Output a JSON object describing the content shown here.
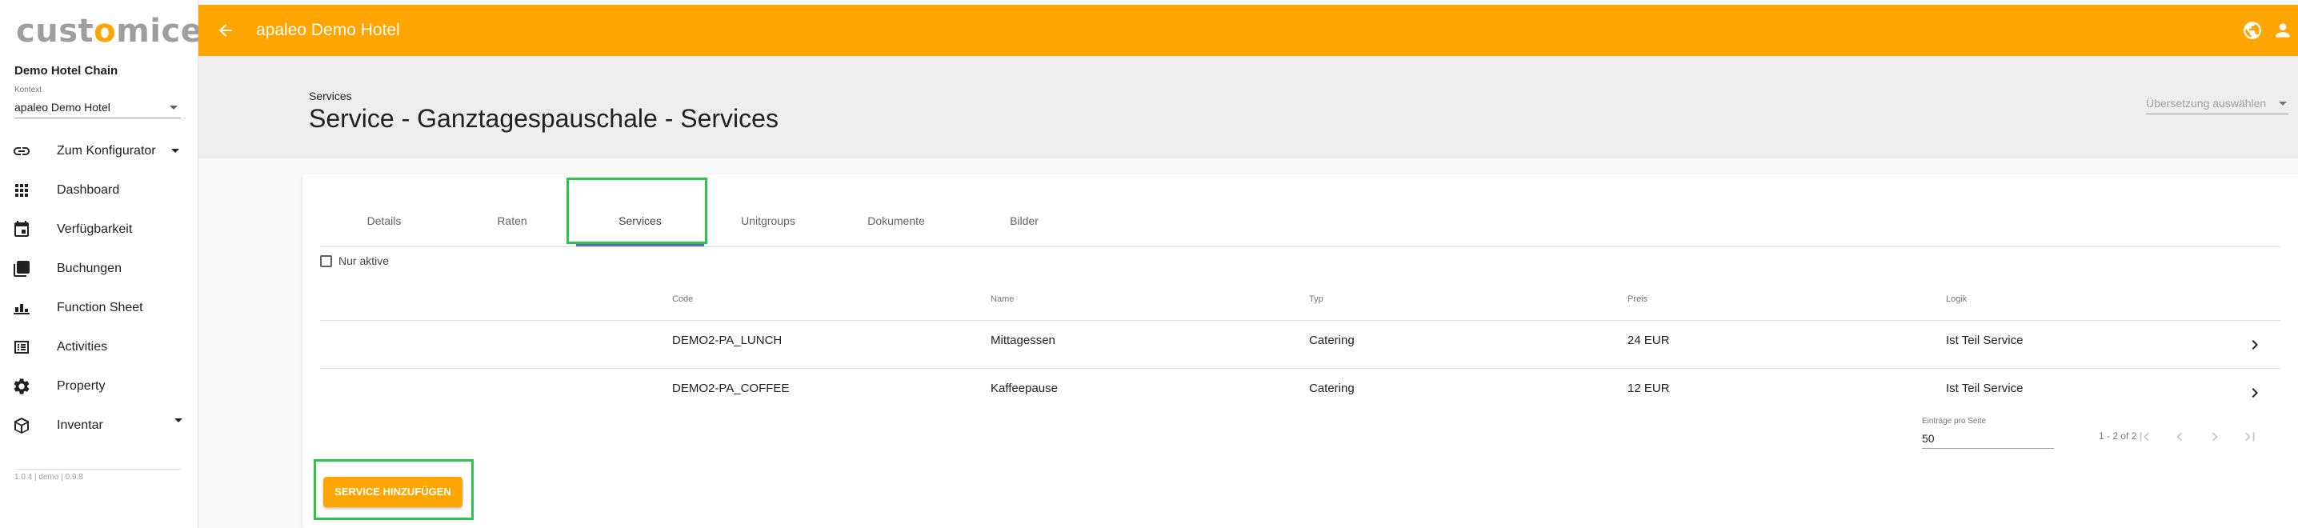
{
  "app": {
    "logo_prefix": "cust",
    "logo_dot": "o",
    "logo_suffix": "mice",
    "accent_color": "#ffa500",
    "highlight_color": "#2ec34a"
  },
  "sidebar": {
    "chain_name": "Demo Hotel Chain",
    "context_label": "Kontext",
    "context_value": "apaleo Demo Hotel",
    "items": [
      {
        "label": "Zum Konfigurator",
        "icon": "link-icon",
        "has_caret": true
      },
      {
        "label": "Dashboard",
        "icon": "grid-icon"
      },
      {
        "label": "Verfügbarkeit",
        "icon": "calendar-icon"
      },
      {
        "label": "Buchungen",
        "icon": "stack-icon"
      },
      {
        "label": "Function Sheet",
        "icon": "bar-chart-icon"
      },
      {
        "label": "Activities",
        "icon": "list-icon"
      },
      {
        "label": "Property",
        "icon": "gear-icon"
      },
      {
        "label": "Inventar",
        "icon": "cube-icon",
        "has_caret": true
      }
    ],
    "version": "1.0.4 | demo | 0.9.8"
  },
  "topbar": {
    "title": "apaleo Demo Hotel"
  },
  "header": {
    "breadcrumb": "Services",
    "title": "Service - Ganztagespauschale - Services",
    "translation_placeholder": "Übersetzung auswählen"
  },
  "tabs": [
    {
      "label": "Details"
    },
    {
      "label": "Raten"
    },
    {
      "label": "Services",
      "active": true
    },
    {
      "label": "Unitgroups"
    },
    {
      "label": "Dokumente"
    },
    {
      "label": "Bilder"
    }
  ],
  "filter": {
    "only_active_label": "Nur aktive",
    "checked": false
  },
  "table": {
    "columns": [
      "Code",
      "Name",
      "Typ",
      "Preis",
      "Logik"
    ],
    "rows": [
      {
        "code": "DEMO2-PA_LUNCH",
        "name": "Mittagessen",
        "type": "Catering",
        "price": "24 EUR",
        "logic": "Ist Teil Service"
      },
      {
        "code": "DEMO2-PA_COFFEE",
        "name": "Kaffeepause",
        "type": "Catering",
        "price": "12 EUR",
        "logic": "Ist Teil Service"
      }
    ]
  },
  "paginator": {
    "per_page_label": "Einträge pro Seite",
    "per_page_value": "50",
    "range": "1 - 2 of 2"
  },
  "actions": {
    "add_service": "SERVICE HINZUFÜGEN"
  }
}
